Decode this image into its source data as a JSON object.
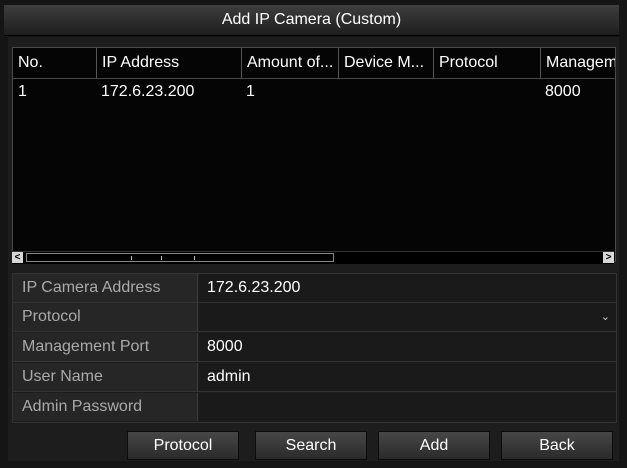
{
  "dialog": {
    "title": "Add IP Camera (Custom)"
  },
  "table": {
    "columns": [
      "No.",
      "IP Address",
      "Amount of...",
      "Device M...",
      "Protocol",
      "Managem"
    ],
    "rows": [
      {
        "no": "1",
        "ip": "172.6.23.200",
        "amount": "1",
        "device_model": "",
        "protocol": "",
        "management": "8000"
      }
    ]
  },
  "scrollbar": {
    "left_arrow": "<",
    "right_arrow": ">"
  },
  "form": {
    "ip_camera_address": {
      "label": "IP Camera Address",
      "value": "172.6.23.200"
    },
    "protocol": {
      "label": "Protocol",
      "value": ""
    },
    "management_port": {
      "label": "Management Port",
      "value": "8000"
    },
    "user_name": {
      "label": "User Name",
      "value": "admin"
    },
    "admin_password": {
      "label": "Admin Password",
      "value": ""
    }
  },
  "buttons": {
    "protocol": "Protocol",
    "search": "Search",
    "add": "Add",
    "back": "Back"
  },
  "icons": {
    "dropdown": "chevron-down-icon"
  }
}
